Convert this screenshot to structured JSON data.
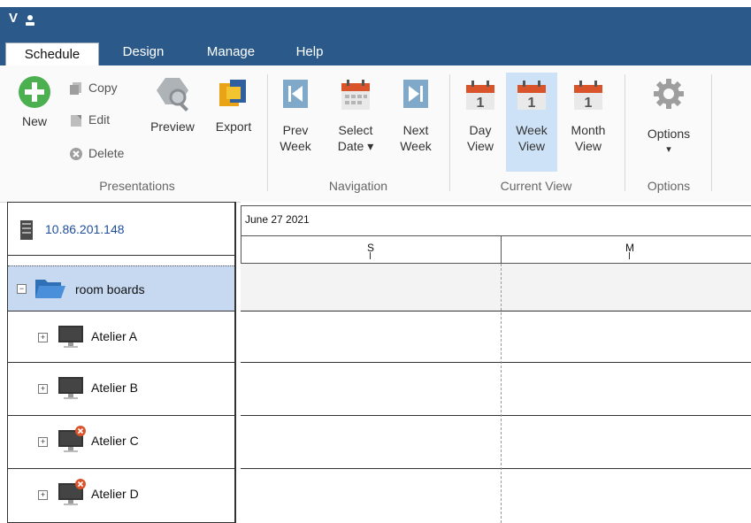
{
  "title_bar": {
    "app_initial": "V",
    "user_icon": "user-icon"
  },
  "tabs": [
    {
      "label": "Schedule",
      "active": true
    },
    {
      "label": "Design",
      "active": false
    },
    {
      "label": "Manage",
      "active": false
    },
    {
      "label": "Help",
      "active": false
    }
  ],
  "ribbon": {
    "presentations": {
      "group_label": "Presentations",
      "new_label": "New",
      "copy_label": "Copy",
      "edit_label": "Edit",
      "delete_label": "Delete",
      "preview_label": "Preview",
      "export_label": "Export"
    },
    "navigation": {
      "group_label": "Navigation",
      "prev_line1": "Prev",
      "prev_line2": "Week",
      "select_line1": "Select",
      "select_line2": "Date ▾",
      "next_line1": "Next",
      "next_line2": "Week"
    },
    "current_view": {
      "group_label": "Current View",
      "day_line1": "Day",
      "day_line2": "View",
      "week_line1": "Week",
      "week_line2": "View",
      "month_line1": "Month",
      "month_line2": "View",
      "calendar_number": "1",
      "selected": "week"
    },
    "options": {
      "group_label": "Options",
      "options_label": "Options",
      "options_arrow": "▾"
    }
  },
  "tree": {
    "server": {
      "label": "10.86.201.148",
      "icon": "server-icon"
    },
    "folder": {
      "label": "room boards",
      "icon": "folder-icon",
      "expander": "−"
    },
    "displays": [
      {
        "label": "Atelier A",
        "status": "ok",
        "expander": "+"
      },
      {
        "label": "Atelier B",
        "status": "ok",
        "expander": "+"
      },
      {
        "label": "Atelier C",
        "status": "error",
        "expander": "+"
      },
      {
        "label": "Atelier D",
        "status": "error",
        "expander": "+"
      }
    ]
  },
  "schedule": {
    "date_label": "June 27 2021",
    "days": [
      "S",
      "M"
    ]
  },
  "colors": {
    "titlebar": "#2b5a8a",
    "selection": "#c6d9f1",
    "accent_green": "#4caf50",
    "calendar_red": "#d9532b",
    "nav_blue": "#7fa8c9"
  }
}
